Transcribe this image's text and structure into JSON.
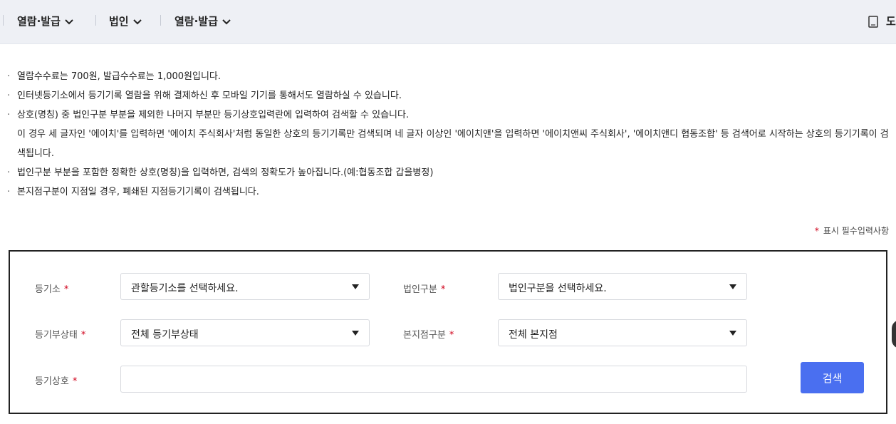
{
  "breadcrumb": {
    "item1": "열람·발급",
    "item2": "법인",
    "item3": "열람·발급",
    "right_label": "도"
  },
  "notes": [
    "열람수수료는 700원, 발급수수료는 1,000원입니다.",
    "인터넷등기소에서 등기기록 열람을 위해 결제하신 후 모바일 기기를 통해서도 열람하실 수 있습니다.",
    "상호(명칭) 중 법인구분 부분을 제외한 나머지 부분만 등기상호입력란에 입력하여 검색할 수 있습니다.",
    "이 경우 세 글자인 '에이치'를 입력하면 '에이치 주식회사'처럼 동일한 상호의 등기기록만 검색되며 네 글자 이상인 '에이치앤'을 입력하면 '에이치앤씨 주식회사', '에이치앤디 협동조합' 등 검색어로 시작하는 상호의 등기기록이 검색됩니다.",
    "법인구분 부분을 포함한 정확한 상호(명칭)을 입력하면, 검색의 정확도가 높아집니다.(예:협동조합 갑을병정)",
    "본지점구분이 지점일 경우, 폐쇄된 지점등기기록이 검색됩니다."
  ],
  "required_note": {
    "star": "*",
    "text": "표시 필수입력사항"
  },
  "form": {
    "registry_office_label": "등기소",
    "registry_office_value": "관할등기소를 선택하세요.",
    "corp_type_label": "법인구분",
    "corp_type_value": "법인구분을 선택하세요.",
    "status_label": "등기부상태",
    "status_value": "전체 등기부상태",
    "branch_label": "본지점구분",
    "branch_value": "전체 본지점",
    "name_label": "등기상호",
    "name_value": "",
    "req_mark": "*",
    "search_label": "검색"
  },
  "colors": {
    "accent": "#4a6ff0",
    "required": "#d0021b",
    "topbar_bg": "#eef0f5"
  }
}
